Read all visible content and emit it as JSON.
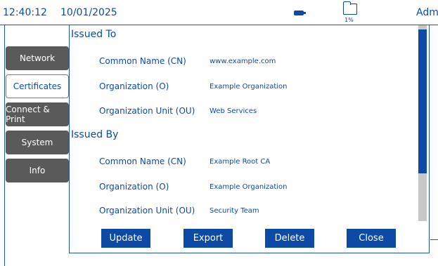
{
  "status_bar": {
    "time": "12:40:12",
    "date": "10/01/2025",
    "usb_icon": "usb-icon",
    "folder_icon": "folder-icon",
    "storage_usage": "1%",
    "user": "Admin"
  },
  "sidebar": {
    "items": [
      {
        "label": "Network",
        "selected": false
      },
      {
        "label": "Certificates",
        "selected": true
      },
      {
        "label": "Connect & Print",
        "selected": false
      },
      {
        "label": "System",
        "selected": false
      },
      {
        "label": "Info",
        "selected": false
      }
    ]
  },
  "certificate": {
    "issued_to": {
      "heading": "Issued To",
      "fields": [
        {
          "label": "Common Name (CN)",
          "value": "www.example.com"
        },
        {
          "label": "Organization (O)",
          "value": "Example Organization"
        },
        {
          "label": "Organization Unit (OU)",
          "value": "Web Services"
        }
      ]
    },
    "issued_by": {
      "heading": "Issued By",
      "fields": [
        {
          "label": "Common Name (CN)",
          "value": "Example Root CA"
        },
        {
          "label": "Organization (O)",
          "value": "Example Organization"
        },
        {
          "label": "Organization Unit (OU)",
          "value": "Security Team"
        }
      ]
    }
  },
  "actions": {
    "update": "Update",
    "export": "Export",
    "delete": "Delete",
    "close": "Close"
  },
  "colors": {
    "accent": "#0d4aa5",
    "nav_dark": "#5a5a5a",
    "scroll_track": "#c7c7c7"
  }
}
